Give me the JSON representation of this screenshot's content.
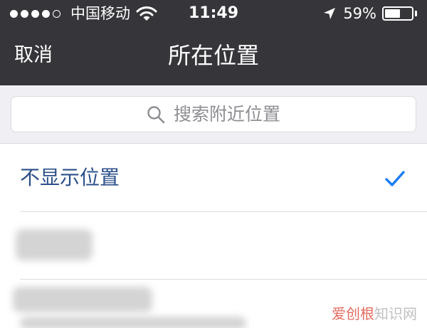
{
  "status_bar": {
    "carrier": "中国移动",
    "time": "11:49",
    "battery_percent": "59%",
    "battery_level": 0.59,
    "signal_bars_filled": 4,
    "signal_bars_total": 5
  },
  "nav": {
    "cancel_label": "取消",
    "title": "所在位置"
  },
  "search": {
    "placeholder": "搜索附近位置"
  },
  "options": {
    "hide_location_label": "不显示位置",
    "hide_location_selected": true
  },
  "watermark": {
    "brand": "爱创根",
    "site": "知识网"
  },
  "colors": {
    "header_bg": "#36363a",
    "link_blue": "#2b4f8a",
    "check_blue": "#1a7cf5",
    "search_bg": "#efeff4",
    "watermark_red": "#e46b5e"
  },
  "icons": [
    "wifi-icon",
    "location-arrow-icon",
    "battery-icon",
    "search-icon",
    "checkmark-icon"
  ]
}
